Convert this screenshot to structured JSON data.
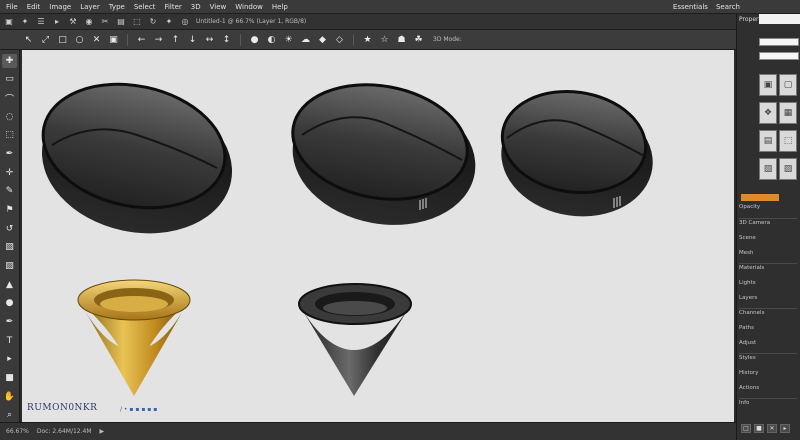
{
  "menubar": {
    "items": [
      "File",
      "Edit",
      "Image",
      "Layer",
      "Type",
      "Select",
      "Filter",
      "3D",
      "View",
      "Window",
      "Help"
    ],
    "right_items": [
      "Essentials",
      "Search"
    ]
  },
  "subbar": {
    "glyphs": [
      "▣",
      "✦",
      "☰",
      "▸",
      "⚒",
      "◉",
      "✂",
      "▤",
      "⬚",
      "↻",
      "✦",
      "◎"
    ],
    "text": "Untitled-1 @ 66.7% (Layer 1, RGB/8)"
  },
  "optbar": {
    "options": [
      "↖",
      "⤢",
      "□",
      "○",
      "✕",
      "▣",
      "←",
      "→",
      "↑",
      "↓",
      "↔",
      "↕",
      "●",
      "◐",
      "☀",
      "☁",
      "◆",
      "◇",
      "★",
      "☆",
      "☗",
      "☘"
    ],
    "field_text": "3D Mode:"
  },
  "lefttools": {
    "icons": [
      "move-icon",
      "marquee-icon",
      "lasso-icon",
      "quick-select-icon",
      "crop-icon",
      "eyedropper-icon",
      "healing-icon",
      "brush-icon",
      "stamp-icon",
      "history-brush-icon",
      "eraser-icon",
      "gradient-icon",
      "blur-icon",
      "dodge-icon",
      "pen-icon",
      "type-icon",
      "path-select-icon",
      "shape-icon",
      "hand-icon",
      "zoom-icon"
    ],
    "glyphs": [
      "✚",
      "▭",
      "⌒",
      "◌",
      "⬚",
      "✒",
      "✛",
      "✎",
      "⚑",
      "↺",
      "▧",
      "▨",
      "▲",
      "●",
      "✒",
      "T",
      "▸",
      "■",
      "✋",
      "⌕"
    ]
  },
  "canvas": {
    "caption": "RUMON0NKR",
    "caption_sub": "/ • ▪ ▪ ▪ ▪ ▪"
  },
  "statusbar": {
    "items": [
      "66.67%",
      "Doc: 2.64M/12.4M",
      "▶"
    ]
  },
  "rightpanel": {
    "header": "Properties",
    "rows": [
      "3D Camera",
      "Scene",
      "Mesh",
      "Materials",
      "Lights",
      "Layers",
      "Channels",
      "Paths",
      "Adjust",
      "Styles",
      "History",
      "Actions",
      "Info"
    ],
    "thumbs": [
      "▣",
      "▢",
      "❖",
      "▦",
      "▤",
      "⬚",
      "▧",
      "▨"
    ],
    "accent_label": "Opacity"
  },
  "colors": {
    "canvas_bg": "#e3e3e3",
    "ui_dark": "#2b2b2b",
    "accent_orange": "#e08a2c",
    "object_black": "#1c1c1c",
    "object_gold": "#c9962a"
  }
}
